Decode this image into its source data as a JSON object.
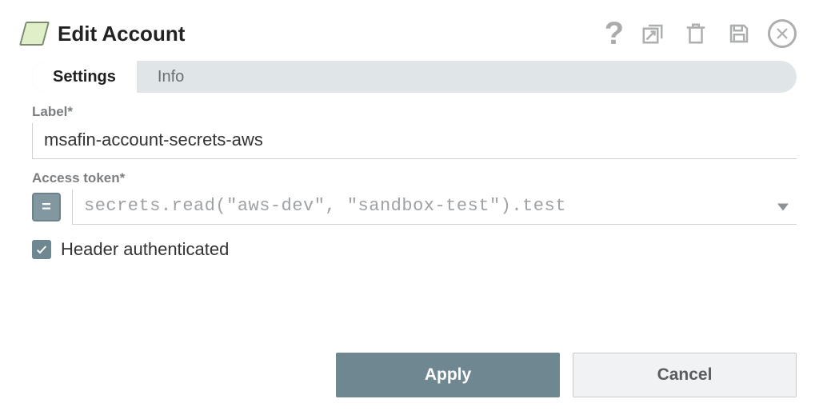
{
  "dialog": {
    "title": "Edit Account"
  },
  "tabs": {
    "settings": "Settings",
    "info": "Info"
  },
  "form": {
    "label_field": {
      "label": "Label*",
      "value": "msafin-account-secrets-aws"
    },
    "token_field": {
      "label": "Access token*",
      "expr_symbol": "=",
      "value": "secrets.read(\"aws-dev\", \"sandbox-test\").test"
    },
    "header_auth": {
      "label": "Header authenticated",
      "checked": true
    }
  },
  "buttons": {
    "apply": "Apply",
    "cancel": "Cancel"
  }
}
